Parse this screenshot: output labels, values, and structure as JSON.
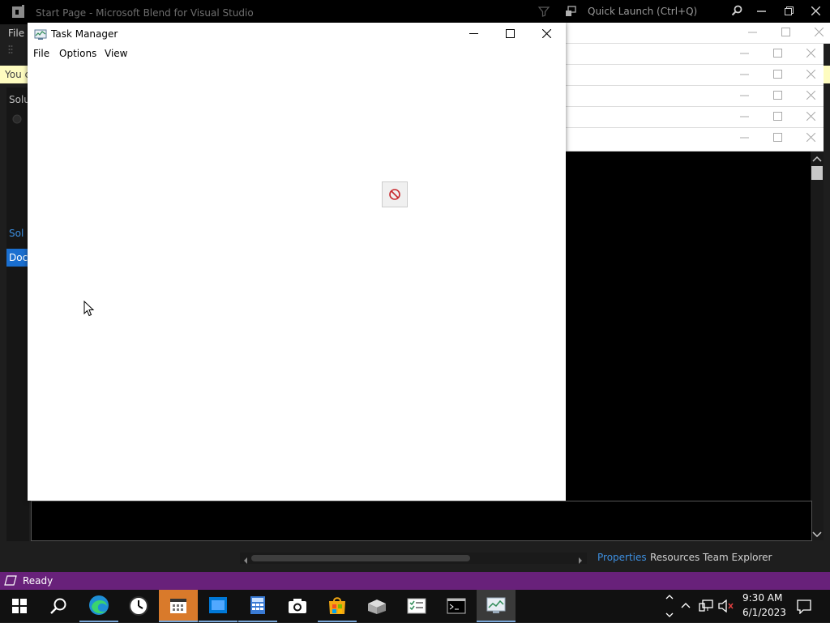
{
  "blend": {
    "title": "Start Page - Microsoft Blend for Visual Studio",
    "quick_launch_placeholder": "Quick Launch (Ctrl+Q)",
    "menu_file": "File",
    "notice_text": "You c",
    "solution_label": "Solu",
    "solution_tab": "Sol",
    "document_tab": "Doc",
    "bottom_tabs": [
      "Properties",
      "Resources",
      "Team Explorer"
    ]
  },
  "status": {
    "text": "Ready"
  },
  "task_manager": {
    "title": "Task Manager",
    "menu": [
      "File",
      "Options",
      "View"
    ]
  },
  "taskbar": {
    "apps": [
      "start-icon",
      "search-icon",
      "edge-icon",
      "clock-app-icon",
      "calendar-icon",
      "store-window-icon",
      "calculator-icon",
      "camera-icon",
      "microsoft-store-icon",
      "package-icon",
      "checklist-icon",
      "terminal-icon",
      "task-manager-icon"
    ],
    "time": "9:30 AM",
    "date": "6/1/2023"
  },
  "colors": {
    "status_bar": "#68217a",
    "accent_blue": "#3d8fe0",
    "taskbar": "#111111"
  }
}
